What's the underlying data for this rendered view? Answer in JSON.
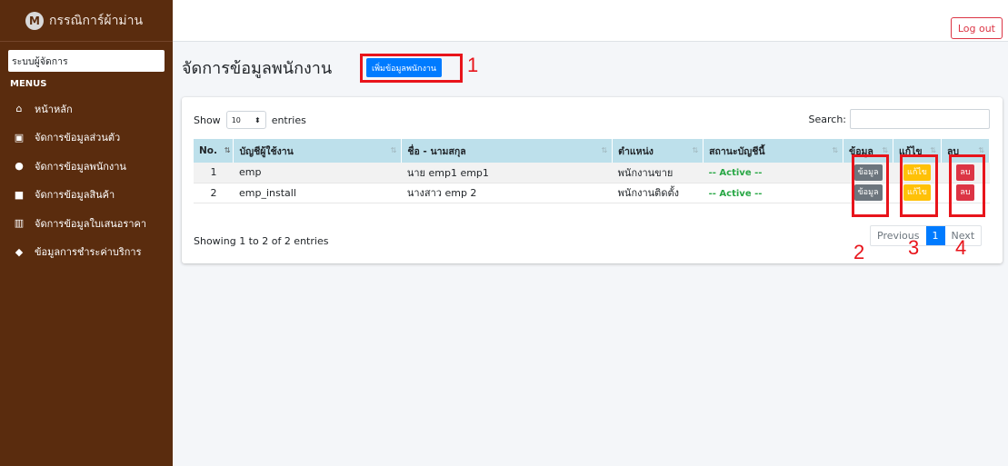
{
  "brand": {
    "logo_letter": "M",
    "name": "กรรณิการ์ผ้าม่าน"
  },
  "sidebar": {
    "user_label": "ระบบผู้จัดการ",
    "menus_header": "MENUS",
    "items": [
      {
        "label": "หน้าหลัก",
        "icon": "home-icon",
        "glyph": "⌂"
      },
      {
        "label": "จัดการข้อมูลส่วนตัว",
        "icon": "id-card-icon",
        "glyph": "▣"
      },
      {
        "label": "จัดการข้อมูลพนักงาน",
        "icon": "users-icon",
        "glyph": "●"
      },
      {
        "label": "จัดการข้อมูลสินค้า",
        "icon": "product-icon",
        "glyph": "■"
      },
      {
        "label": "จัดการข้อมูลใบเสนอราคา",
        "icon": "chart-icon",
        "glyph": "▥"
      },
      {
        "label": "ข้อมูลการชำระค่าบริการ",
        "icon": "truck-icon",
        "glyph": "◆"
      }
    ]
  },
  "topbar": {
    "logout_label": "Log out"
  },
  "main": {
    "title": "จัดการข้อมูลพนักงาน",
    "add_button": "เพิ่มข้อมูลพนักงาน",
    "annotations": [
      "1",
      "2",
      "3",
      "4"
    ]
  },
  "table_controls": {
    "show_label": "Show",
    "entries_value": "10",
    "entries_label": "entries",
    "search_label": "Search:"
  },
  "table": {
    "headers": [
      "No.",
      "บัญชีผู้ใช้งาน",
      "ชื่อ - นามสกุล",
      "ตำแหน่ง",
      "สถานะบัญชีนี้",
      "ข้อมูล",
      "แก้ไข",
      "ลบ"
    ],
    "rows": [
      {
        "no": "1",
        "username": "emp",
        "fullname": "นาย emp1 emp1",
        "position": "พนักงานขาย",
        "status": "-- Active --",
        "view": "ข้อมูล",
        "edit": "แก้ไข",
        "delete": "ลบ"
      },
      {
        "no": "2",
        "username": "emp_install",
        "fullname": "นางสาว emp 2",
        "position": "พนักงานติดตั้ง",
        "status": "-- Active --",
        "view": "ข้อมูล",
        "edit": "แก้ไข",
        "delete": "ลบ"
      }
    ]
  },
  "footer": {
    "info": "Showing 1 to 2 of 2 entries",
    "previous": "Previous",
    "page": "1",
    "next": "Next"
  },
  "colors": {
    "sidebar_bg": "#5a2c0e",
    "primary": "#007bff",
    "danger": "#dc3545",
    "warning": "#ffc107",
    "success": "#28a745",
    "annotation_red": "#e8141b"
  }
}
